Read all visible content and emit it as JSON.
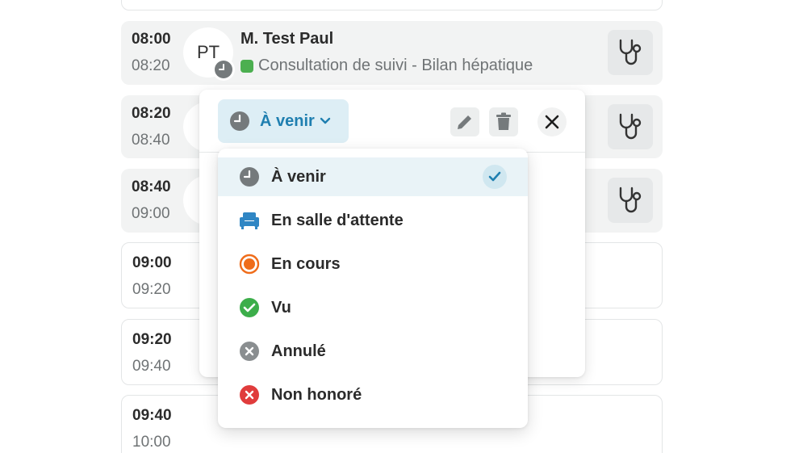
{
  "slots": [
    {
      "start": "08:00",
      "end": "08:20",
      "avatar_initials": "PT",
      "patient_name": "M. Test Paul",
      "appointment_type": "Consultation de suivi - Bilan hépatique"
    },
    {
      "start": "08:20",
      "end": "08:40"
    },
    {
      "start": "08:40",
      "end": "09:00"
    },
    {
      "start": "09:00",
      "end": "09:20"
    },
    {
      "start": "09:20",
      "end": "09:40"
    },
    {
      "start": "09:40",
      "end": "10:00"
    }
  ],
  "status_panel": {
    "current_status": "À venir"
  },
  "status_menu": {
    "items": [
      {
        "label": "À venir",
        "icon": "clock-icon",
        "color": "#757a7c",
        "selected": true
      },
      {
        "label": "En salle d'attente",
        "icon": "armchair-icon",
        "color": "#2f86c4"
      },
      {
        "label": "En cours",
        "icon": "in-progress-icon",
        "color": "#ef6c1a"
      },
      {
        "label": "Vu",
        "icon": "check-circle-icon",
        "color": "#3cae4a"
      },
      {
        "label": "Annulé",
        "icon": "x-circle-icon",
        "color": "#8a8e90"
      },
      {
        "label": "Non honoré",
        "icon": "x-circle-icon",
        "color": "#e03c3c"
      }
    ]
  },
  "colors": {
    "accent": "#1f7fb0",
    "appointment_type_dot": "#4caf50",
    "slot_filled_bg": "#f2f3f3"
  }
}
